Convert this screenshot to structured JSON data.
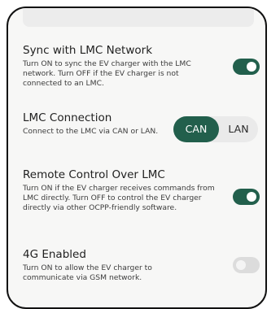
{
  "settings": [
    {
      "title": "Sync with LMC Network",
      "description": "Turn ON to sync the EV charger with the LMC network. Turn OFF if the EV charger is not connected to an LMC.",
      "state": "on"
    },
    {
      "title": "LMC Connection",
      "description": "Connect to the LMC via CAN or LAN.",
      "options": [
        "CAN",
        "LAN"
      ],
      "selected": "CAN"
    },
    {
      "title": "Remote Control Over LMC",
      "description": "Turn ON if the EV charger receives commands from LMC directly. Turn OFF to control the EV charger directly via other OCPP-friendly software.",
      "state": "on"
    },
    {
      "title": "4G Enabled",
      "description": "Turn ON to allow the EV charger to communicate via GSM network.",
      "state": "off"
    }
  ],
  "colors": {
    "accent": "#225f4c",
    "background": "#f7f7f6",
    "toggle_off": "#dcdcdc"
  }
}
